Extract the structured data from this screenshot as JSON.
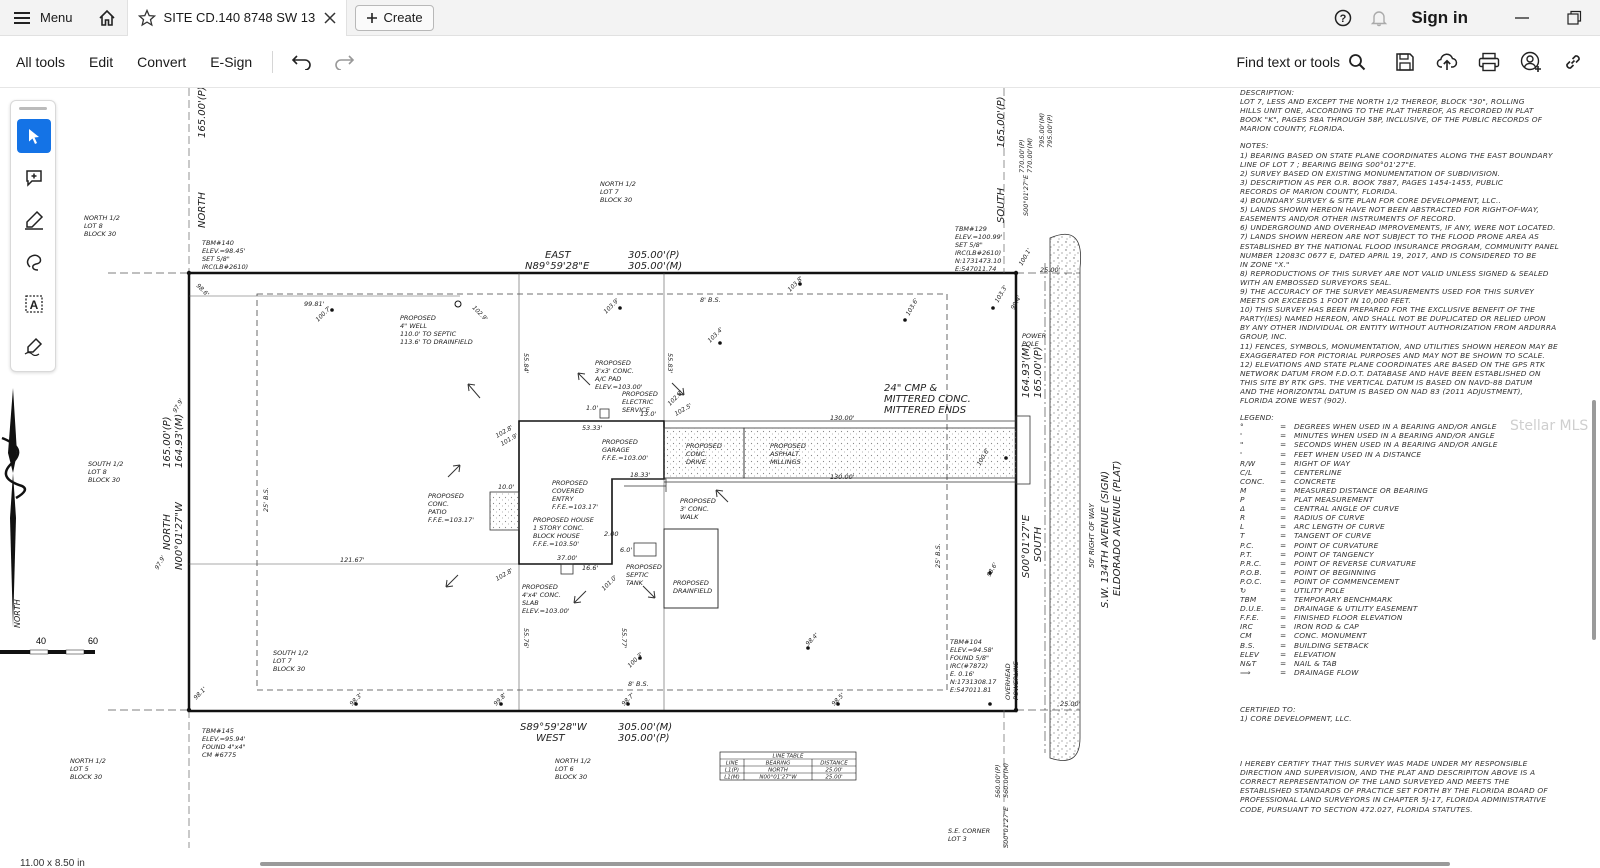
{
  "tabbar": {
    "menu_label": "Menu",
    "tab_title": "SITE CD.140 8748 SW 13...",
    "create_label": "Create",
    "sign_in_label": "Sign in"
  },
  "toolbar": {
    "items": [
      "All tools",
      "Edit",
      "Convert",
      "E-Sign"
    ],
    "find_label": "Find text or tools"
  },
  "status": {
    "page_size": "11.00 x 8.50 in"
  },
  "watermark": "Stellar MLS",
  "plan": {
    "scale_ticks": [
      "40",
      "60"
    ],
    "top_dims": [
      "305.00'(P)",
      "305.00'(M)"
    ],
    "top_bearing": [
      "EAST",
      "N89°59'28\"E"
    ],
    "bottom_dims": [
      "305.00'(M)",
      "305.00'(P)"
    ],
    "bottom_bearing": [
      "S89°59'28\"W",
      "WEST"
    ],
    "left_dims": [
      "165.00'(P)",
      "164.93'(M)"
    ],
    "left_bearing": [
      "NORTH",
      "N00°01'27\"W"
    ],
    "right_dims": [
      "164.93'(M)",
      "165.00'(P)"
    ],
    "right_bearing": [
      "S00°01'27\"E",
      "SOUTH"
    ],
    "top_left_dim": "165.00'(P)",
    "top_right_dim": "165.00'(P)",
    "north_label": "NORTH",
    "south_label": "SOUTH",
    "road_name": [
      "S.W. 134TH AVENUE (SIGN)",
      "ELDORADO AVENUE (PLAT)"
    ],
    "row_label": "50' RIGHT OF WAY",
    "lot_labels": {
      "north_lot7": [
        "NORTH 1/2",
        "LOT 7",
        "BLOCK 30"
      ],
      "north_lot8": [
        "NORTH 1/2",
        "LOT 8",
        "BLOCK 30"
      ],
      "south_lot8": [
        "SOUTH 1/2",
        "LOT 8",
        "BLOCK 30"
      ],
      "south_lot7": [
        "SOUTH 1/2",
        "LOT 7",
        "BLOCK 30"
      ],
      "north_lot5": [
        "NORTH 1/2",
        "LOT 5",
        "BLOCK 30"
      ],
      "north_lot6": [
        "NORTH 1/2",
        "LOT 6",
        "BLOCK 30"
      ],
      "se_corner": [
        "S.E. CORNER",
        "LOT 3"
      ]
    },
    "tbm140": [
      "TBM#140",
      "ELEV.=98.45'",
      "SET 5/8\"",
      "IRC(LB#2610)"
    ],
    "tbm129": [
      "TBM#129",
      "ELEV.=100.99'",
      "SET 5/8\"",
      "IRC(LB#2610)",
      "N:1731473.10",
      "E:547011.74"
    ],
    "tbm145": [
      "TBM#145",
      "ELEV.=95.94'",
      "FOUND 4\"x4\"",
      "CM #6775"
    ],
    "tbm104": [
      "TBM#104",
      "ELEV.=94.58'",
      "FOUND 5/8\"",
      "IRC(#7872)",
      "E. 0.16'",
      "N:1731308.17",
      "E:547011.81"
    ],
    "well": [
      "PROPOSED",
      "4\" WELL",
      "110.0' TO SEPTIC",
      "113.6' TO DRAINFIELD"
    ],
    "ac_pad": [
      "PROPOSED",
      "3'x3' CONC.",
      "A/C PAD",
      "ELEV.=103.00'"
    ],
    "electric": [
      "PROPOSED",
      "ELECTRIC",
      "SERVICE"
    ],
    "garage": [
      "PROPOSED",
      "GARAGE",
      "F.F.E.=103.00'"
    ],
    "drive": [
      "PROPOSED",
      "CONC.",
      "DRIVE"
    ],
    "asphalt": [
      "PROPOSED",
      "ASPHALT",
      "MILLINGS"
    ],
    "entry": [
      "PROPOSED",
      "COVERED",
      "ENTRY",
      "F.F.E.=103.17'"
    ],
    "house": [
      "PROPOSED HOUSE",
      "1 STORY CONC.",
      "BLOCK HOUSE",
      "F.F.E.=103.50'"
    ],
    "patio": [
      "PROPOSED",
      "CONC.",
      "PATIO",
      "F.F.E.=103.17'"
    ],
    "walk": [
      "PROPOSED",
      "3' CONC.",
      "WALK"
    ],
    "slab": [
      "PROPOSED",
      "4'x4' CONC.",
      "SLAB",
      "ELEV.=103.00'"
    ],
    "septic": [
      "PROPOSED",
      "SEPTIC",
      "TANK"
    ],
    "drainfield": [
      "PROPOSED",
      "DRAINFIELD"
    ],
    "culvert": [
      "24\" CMP & ",
      "MITTERED CONC.",
      "MITTERED ENDS"
    ],
    "power_pole": [
      "POWER",
      "POLE"
    ],
    "overhead": [
      "OVERHEAD",
      "POWERLINE"
    ],
    "setback_8": "8' B.S.",
    "setback_25": "25' B.S.",
    "dims_misc": [
      "130.00'",
      "130.00'",
      "121.67'",
      "99.81'",
      "53.33'",
      "18.33'",
      "37.00'",
      "16.6'",
      "10.0'",
      "14.0'",
      "2.00",
      "6.0'",
      "13.0'",
      "1.0'",
      "6.0'",
      "55.84'",
      "55.83'",
      "55.76'",
      "55.77'",
      "25.00'",
      "25.00'",
      "12.67'",
      "19.33'",
      "21.33'",
      "27.5'",
      "16.0'",
      "16.0'",
      "16.0'"
    ],
    "elevations": [
      "98.6'",
      "102.9'",
      "103.9'",
      "103.8'",
      "103.6'",
      "103.4'",
      "102.8'",
      "102.5'",
      "103.3'",
      "103.5'",
      "100.7'",
      "102.8'",
      "101.9'",
      "102.8'",
      "100.6'",
      "101.0'",
      "100.3'",
      "98.4'",
      "98.6'",
      "99.4'",
      "97.9'",
      "97.9'",
      "98.5'",
      "98.3'",
      "98.7'",
      "98.6'",
      "98.1'",
      "98.3'",
      "99.8'",
      "94.8'",
      "94.1'",
      "100.1'",
      "101.1'",
      "100.6'",
      "100.3'",
      "98.8'",
      "98.6'",
      "97.6'",
      "95.8'",
      "97.3'"
    ],
    "line_table": {
      "title": "LINE TABLE",
      "headers": [
        "LINE",
        "BEARING",
        "DISTANCE"
      ],
      "rows": [
        [
          "L1(P)",
          "NORTH",
          "25.00'"
        ],
        [
          "L1(M)",
          "N00°01'27\"W",
          "25.00'"
        ]
      ]
    },
    "mark_stations": [
      "770.00'(P)",
      "770.00'(M)",
      "795.00'(M)",
      "795.00'(P)",
      "S00°01'27\"E",
      "560.00'(P)",
      "560.00'(M)",
      "S00°01'27\"E"
    ]
  },
  "notes": {
    "description_title": "DESCRIPTION:",
    "description": [
      "LOT 7, LESS AND EXCEPT THE NORTH 1/2 THEREOF, BLOCK \"30\", ROLLING",
      "HILLS UNIT ONE, ACCORDING TO THE PLAT THEREOF, AS RECORDED IN PLAT",
      "BOOK \"K\", PAGES 58A THROUGH 58P, INCLUSIVE, OF THE PUBLIC RECORDS OF",
      "MARION COUNTY, FLORIDA."
    ],
    "notes_title": "NOTES:",
    "notes": [
      "1) BEARING BASED ON STATE PLANE COORDINATES ALONG THE EAST BOUNDARY",
      "LINE OF LOT 7 ; BEARING BEING S00°01'27\"E.",
      "2) SURVEY BASED ON EXISTING MONUMENTATION OF SUBDIVISION.",
      "3) DESCRIPTION AS PER O.R. BOOK 7887, PAGES 1454-1455, PUBLIC",
      "RECORDS OF MARION COUNTY, FLORIDA.",
      "4) BOUNDARY SURVEY & SITE PLAN FOR CORE DEVELOPMENT, LLC..",
      "5) LANDS SHOWN HEREON HAVE NOT BEEN ABSTRACTED FOR RIGHT-OF-WAY,",
      "EASEMENTS AND/OR OTHER INSTRUMENTS OF RECORD.",
      "6) UNDERGROUND AND OVERHEAD IMPROVEMENTS, IF ANY, WERE NOT LOCATED.",
      "7) LANDS SHOWN HEREON ARE NOT SUBJECT TO THE FLOOD PRONE AREA AS",
      "ESTABLISHED BY THE NATIONAL FLOOD INSURANCE PROGRAM, COMMUNITY PANEL",
      "NUMBER 12083C 0677 E, DATED APRIL 19, 2017, AND IS CONSIDERED TO BE",
      "IN ZONE \"X.\"",
      "8) REPRODUCTIONS OF THIS SURVEY ARE NOT VALID UNLESS SIGNED & SEALED",
      "WITH AN EMBOSSED SURVEYORS SEAL.",
      "9) THE ACCURACY OF THE SURVEY MEASUREMENTS USED FOR THIS SURVEY",
      "MEETS OR EXCEEDS 1 FOOT IN 10,000 FEET.",
      "10) THIS SURVEY HAS BEEN PREPARED FOR THE EXCLUSIVE BENEFIT OF THE",
      "PARTY(IES) NAMED HEREON, AND SHALL NOT BE DUPLICATED OR RELIED UPON",
      "BY ANY OTHER INDIVIDUAL OR ENTITY WITHOUT AUTHORIZATION FROM ARDURRA",
      "GROUP, INC.",
      "11) FENCES, SYMBOLS, MONUMENTATION, AND UTILITIES SHOWN HEREON MAY BE",
      "EXAGGERATED FOR PICTORIAL PURPOSES AND MAY NOT BE SHOWN TO SCALE.",
      "12) ELEVATIONS AND STATE PLANE COORDINATES ARE BASED ON THE GPS RTK",
      "NETWORK DATUM FROM F.D.O.T. DATABASE AND HAVE BEEN ESTABLISHED ON",
      "THIS SITE BY RTK GPS. THE VERTICAL DATUM IS BASED ON NAVD-88 DATUM",
      "AND THE HORIZONTAL DATUM IS BASED ON NAD 83 (2011 ADJUSTMENT),",
      "FLORIDA ZONE WEST (902)."
    ],
    "legend_title": "LEGEND:",
    "legend": [
      [
        "°",
        "DEGREES WHEN USED IN A BEARING AND/OR ANGLE"
      ],
      [
        "'",
        "MINUTES WHEN USED IN A BEARING AND/OR ANGLE"
      ],
      [
        "\"",
        "SECONDS WHEN USED IN A BEARING AND/OR ANGLE"
      ],
      [
        "'",
        "FEET WHEN USED IN A DISTANCE"
      ],
      [
        "R/W",
        "RIGHT OF WAY"
      ],
      [
        "C/L",
        "CENTERLINE"
      ],
      [
        "CONC.",
        "CONCRETE"
      ],
      [
        "M",
        "MEASURED DISTANCE OR BEARING"
      ],
      [
        "P",
        "PLAT MEASUREMENT"
      ],
      [
        "Δ",
        "CENTRAL ANGLE OF CURVE"
      ],
      [
        "R",
        "RADIUS OF CURVE"
      ],
      [
        "L",
        "ARC LENGTH OF CURVE"
      ],
      [
        "T",
        "TANGENT OF CURVE"
      ],
      [
        "P.C.",
        "POINT OF CURVATURE"
      ],
      [
        "P.T.",
        "POINT OF TANGENCY"
      ],
      [
        "P.R.C.",
        "POINT OF REVERSE CURVATURE"
      ],
      [
        "P.O.B.",
        "POINT OF BEGINNING"
      ],
      [
        "P.O.C.",
        "POINT OF COMMENCEMENT"
      ],
      [
        "",
        "UTILITY POLE"
      ],
      [
        "TBM",
        "TEMPORARY BENCHMARK"
      ],
      [
        "D.U.E.",
        "DRAINAGE & UTILITY EASEMENT"
      ],
      [
        "F.F.E.",
        "FINISHED FLOOR ELEVATION"
      ],
      [
        "IRC",
        "IRON ROD & CAP"
      ],
      [
        "CM",
        "CONC. MONUMENT"
      ],
      [
        "B.S.",
        "BUILDING SETBACK"
      ],
      [
        "ELEV",
        "ELEVATION"
      ],
      [
        "N&T",
        "NAIL & TAB"
      ],
      [
        "⟹",
        "DRAINAGE FLOW"
      ]
    ],
    "certified_title": "CERTIFIED TO:",
    "certified": [
      "1) CORE DEVELOPMENT, LLC."
    ],
    "certify": [
      "I HEREBY CERTIFY THAT THIS SURVEY WAS MADE UNDER MY RESPONSIBLE",
      "DIRECTION AND SUPERVISION, AND THE PLAT AND DESCRIPITON ABOVE IS A",
      "CORRECT REPRESENTATION OF THE LAND SURVEYED AND MEETS THE",
      "ESTABLISHED STANDARDS OF PRACTICE SET FORTH BY THE FLORIDA BOARD OF",
      "PROFESSIONAL LAND SURVEYORS IN CHAPTER 5J-17, FLORIDA ADMINISTRATIVE",
      "CODE, PURSUANT TO SECTION 472.027, FLORIDA STATUTES."
    ]
  }
}
